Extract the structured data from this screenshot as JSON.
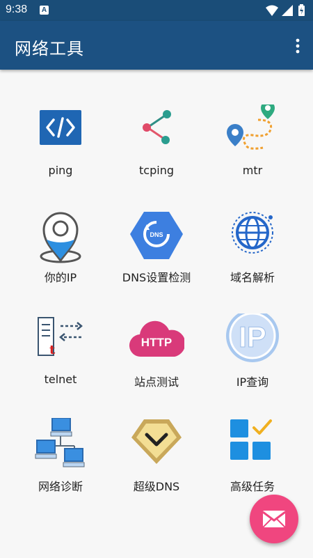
{
  "status_bar": {
    "time": "9:38",
    "notification_badge": "A"
  },
  "app_bar": {
    "title": "网络工具"
  },
  "tools": [
    {
      "label": "ping",
      "icon": "code-icon"
    },
    {
      "label": "tcping",
      "icon": "share-icon"
    },
    {
      "label": "mtr",
      "icon": "route-map-icon"
    },
    {
      "label": "你的IP",
      "icon": "location-pin-icon"
    },
    {
      "label": "DNS设置检测",
      "icon": "dns-settings-icon"
    },
    {
      "label": "域名解析",
      "icon": "globe-icon"
    },
    {
      "label": "telnet",
      "icon": "telnet-transfer-icon"
    },
    {
      "label": "站点测试",
      "icon": "http-cloud-icon"
    },
    {
      "label": "IP查询",
      "icon": "ip-badge-icon"
    },
    {
      "label": "网络诊断",
      "icon": "network-computers-icon"
    },
    {
      "label": "超级DNS",
      "icon": "chevron-badge-icon"
    },
    {
      "label": "高级任务",
      "icon": "tasks-check-icon"
    }
  ],
  "colors": {
    "status_bar": "#1a4d78",
    "app_bar": "#1c5182",
    "fab": "#f0467f",
    "background": "#f7f7f7"
  }
}
